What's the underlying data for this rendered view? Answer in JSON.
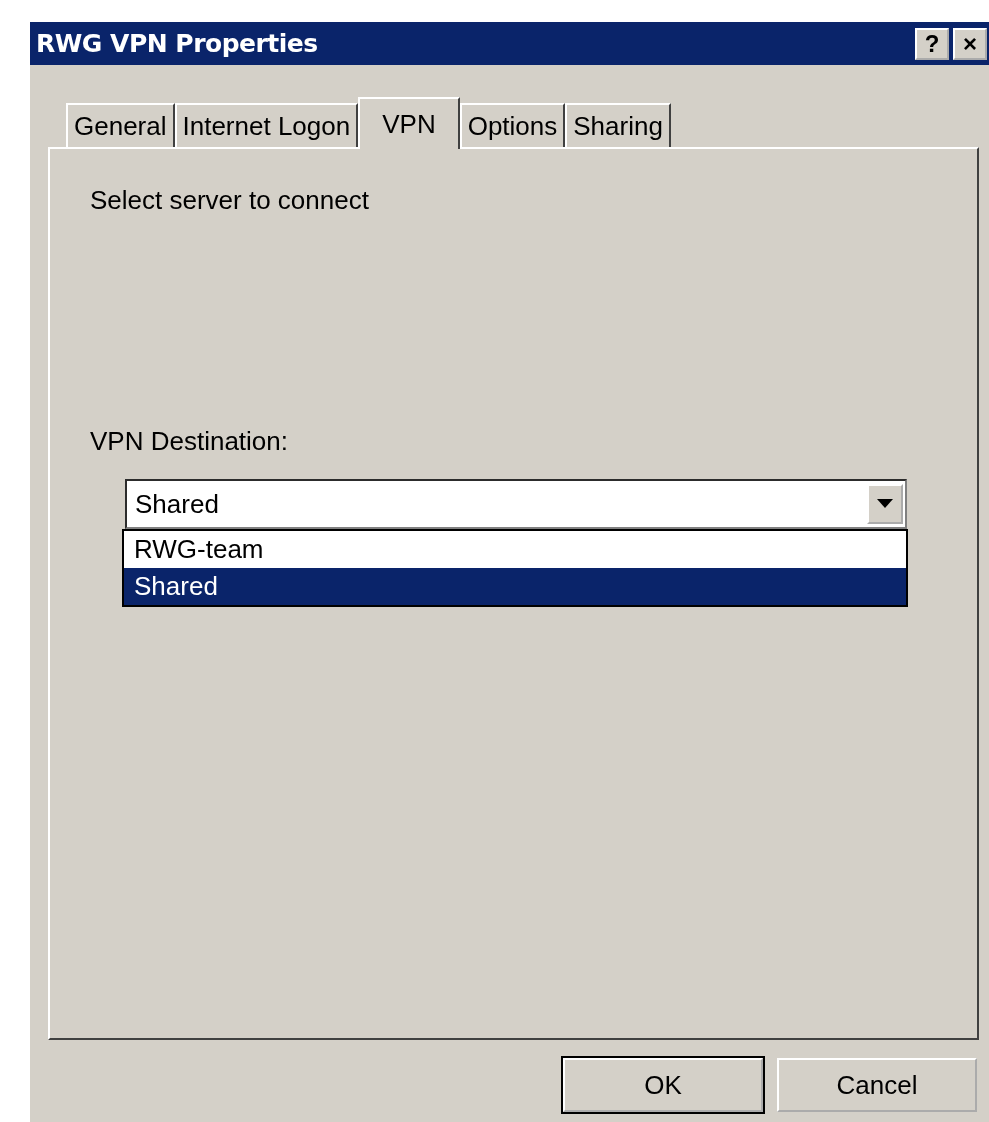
{
  "window": {
    "title": "RWG VPN Properties",
    "title_buttons": [
      "?",
      "×"
    ]
  },
  "tabs": [
    {
      "label": "General",
      "selected": false
    },
    {
      "label": "Internet Logon",
      "selected": false
    },
    {
      "label": "VPN",
      "selected": true
    },
    {
      "label": "Options",
      "selected": false
    },
    {
      "label": "Sharing",
      "selected": false
    }
  ],
  "panel": {
    "instruction": "Select server to connect",
    "destination_label": "VPN Destination:",
    "destination": {
      "value": "Shared",
      "expanded": true,
      "options": [
        {
          "label": "RWG-team",
          "selected": false
        },
        {
          "label": "Shared",
          "selected": true
        }
      ]
    }
  },
  "buttons": [
    {
      "label": "OK",
      "default": true
    },
    {
      "label": "Cancel",
      "default": false
    }
  ]
}
